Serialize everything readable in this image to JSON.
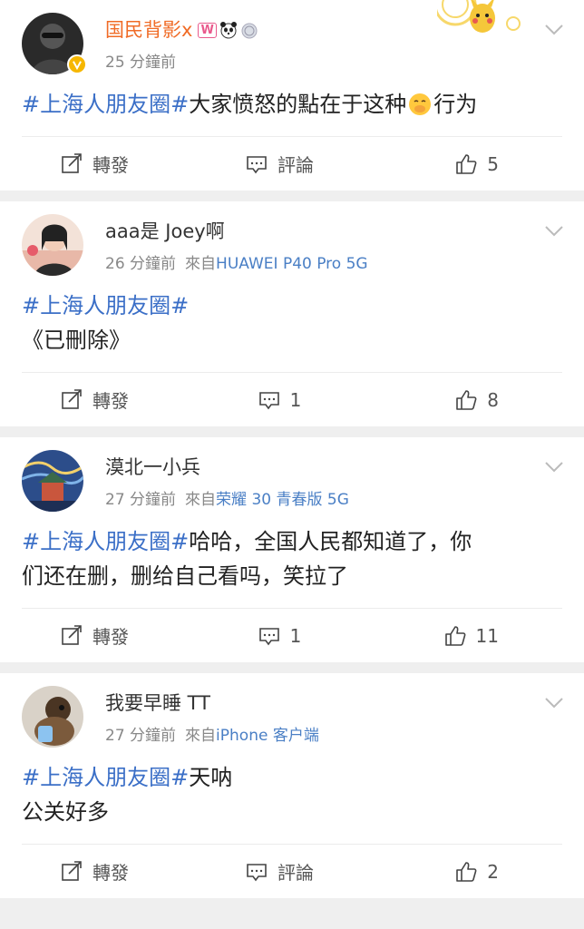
{
  "posts": [
    {
      "username": "国民背影ⅹ",
      "time": "25 分鐘前",
      "source_prefix": "",
      "device": "",
      "topic": "#上海人朋友圈#",
      "text_a": "大家愤怒的點在于这种",
      "text_b": "行为",
      "text_line2": "",
      "repost_label": "轉發",
      "comment_label": "評論",
      "comment_count": "",
      "like_count": "5"
    },
    {
      "username": "aaa是 Joey啊",
      "time": "26 分鐘前",
      "source_prefix": "來自",
      "device": "HUAWEI P40 Pro 5G",
      "topic": "#上海人朋友圈#",
      "text_line2": "《已刪除》",
      "repost_label": "轉發",
      "comment_label": "",
      "comment_count": "1",
      "like_count": "8"
    },
    {
      "username": "漠北一小兵",
      "time": "27 分鐘前",
      "source_prefix": "來自",
      "device": "荣耀 30 青春版 5G",
      "topic": "#上海人朋友圈#",
      "text_a": "哈哈，全国人民都知道了，你",
      "text_line2": "们还在删，删给自己看吗，笑拉了",
      "repost_label": "轉發",
      "comment_label": "",
      "comment_count": "1",
      "like_count": "11"
    },
    {
      "username": "我要早睡 TT",
      "time": "27 分鐘前",
      "source_prefix": "來自",
      "device": "iPhone 客户端",
      "topic": "#上海人朋友圈#",
      "text_a": "天呐",
      "text_line2": "公关好多",
      "repost_label": "轉發",
      "comment_label": "評論",
      "comment_count": "",
      "like_count": "2"
    }
  ],
  "colors": {
    "topic_blue": "#3b6fc7",
    "vip_orange": "#f06b26",
    "device_blue": "#4a7fc5",
    "meta_gray": "#888888"
  },
  "icons": {
    "repost": "repost-icon",
    "comment": "comment-icon",
    "like": "like-icon",
    "menu": "chevron-down-icon"
  }
}
